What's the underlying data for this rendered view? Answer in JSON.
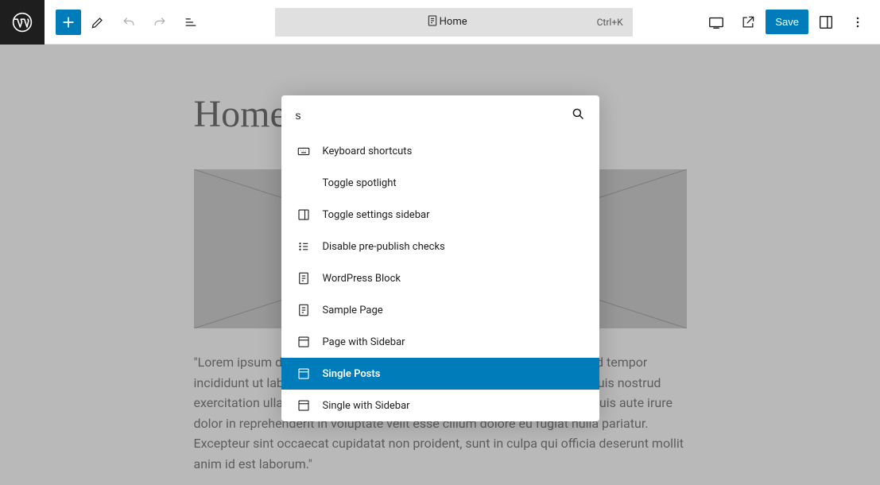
{
  "topbar": {
    "document_title": "Home",
    "shortcut": "Ctrl+K",
    "save_label": "Save"
  },
  "page": {
    "title": "Home",
    "body": "\"Lorem ipsum dolor sit amet, consectetur adipiscing elit, sed do eiusmod tempor incididunt ut labore et dolore magna aliqua. Ut enim ad minim veniam, quis nostrud exercitation ullamco laboris nisi ut aliquip ex ea commodo consequat. Duis aute irure dolor in reprehenderit in voluptate velit esse cillum dolore eu fugiat nulla pariatur. Excepteur sint occaecat cupidatat non proident, sunt in culpa qui officia deserunt mollit anim id est laborum.\""
  },
  "commandPalette": {
    "search_value": "s",
    "items": [
      {
        "label": "Keyboard shortcuts",
        "icon": "keyboard",
        "selected": false
      },
      {
        "label": "Toggle spotlight",
        "icon": "",
        "selected": false
      },
      {
        "label": "Toggle settings sidebar",
        "icon": "sidebar",
        "selected": false
      },
      {
        "label": "Disable pre-publish checks",
        "icon": "checklist",
        "selected": false
      },
      {
        "label": "WordPress Block",
        "icon": "page",
        "selected": false
      },
      {
        "label": "Sample Page",
        "icon": "page",
        "selected": false
      },
      {
        "label": "Page with Sidebar",
        "icon": "layout",
        "selected": false
      },
      {
        "label": "Single Posts",
        "icon": "layout",
        "selected": true
      },
      {
        "label": "Single with Sidebar",
        "icon": "layout",
        "selected": false
      }
    ]
  }
}
